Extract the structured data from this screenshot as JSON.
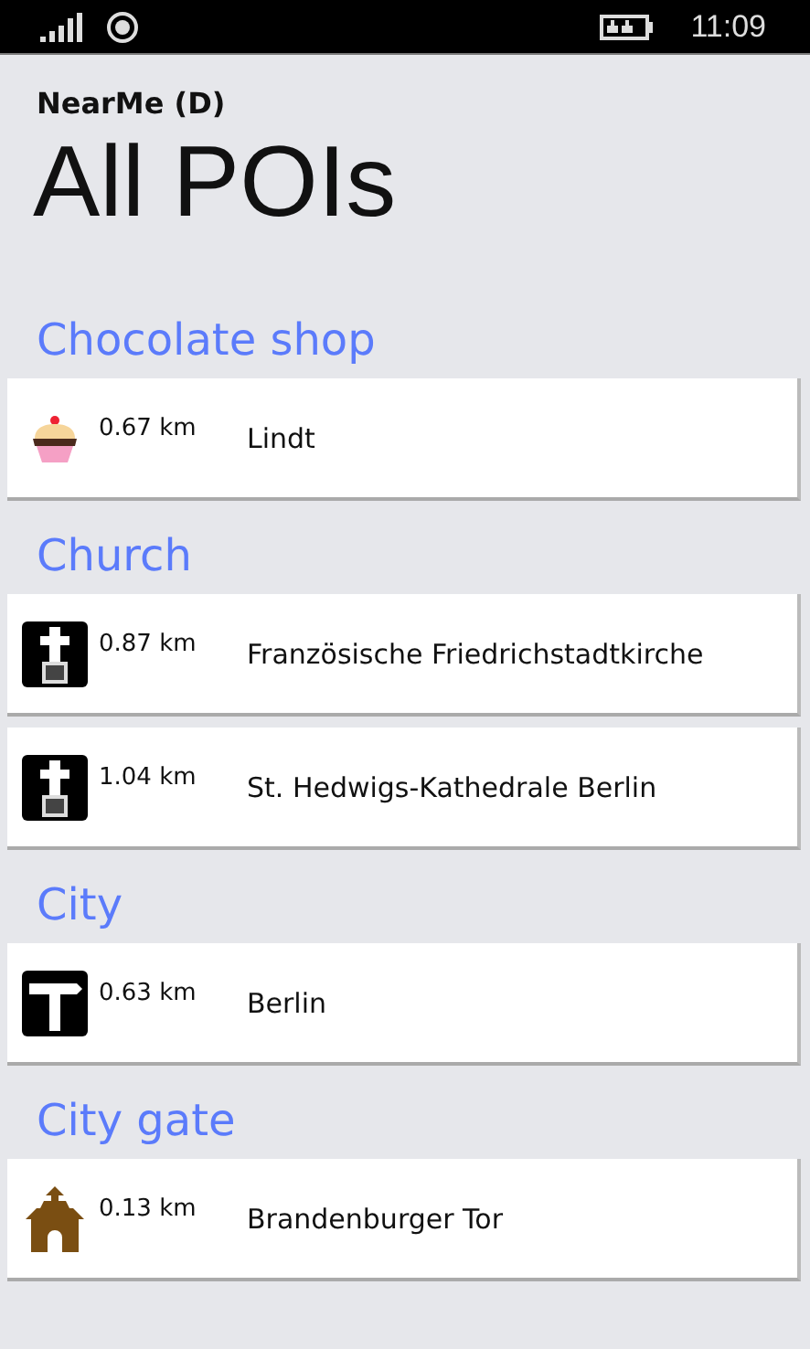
{
  "status_bar": {
    "time": "11:09"
  },
  "app_title": "NearMe (D)",
  "page_title": "All POIs",
  "sections": [
    {
      "header": "Chocolate shop",
      "items": [
        {
          "kind": "cupcake",
          "distance": "0.67 km",
          "name": "Lindt"
        }
      ]
    },
    {
      "header": "Church",
      "items": [
        {
          "kind": "church",
          "distance": "0.87 km",
          "name": "Französische Friedrichstadtkirche"
        },
        {
          "kind": "church",
          "distance": "1.04 km",
          "name": "St. Hedwigs-Kathedrale Berlin"
        }
      ]
    },
    {
      "header": "City",
      "items": [
        {
          "kind": "signpost",
          "distance": "0.63 km",
          "name": "Berlin"
        }
      ]
    },
    {
      "header": "City gate",
      "items": [
        {
          "kind": "gatehouse",
          "distance": "0.13 km",
          "name": "Brandenburger Tor"
        }
      ]
    }
  ]
}
